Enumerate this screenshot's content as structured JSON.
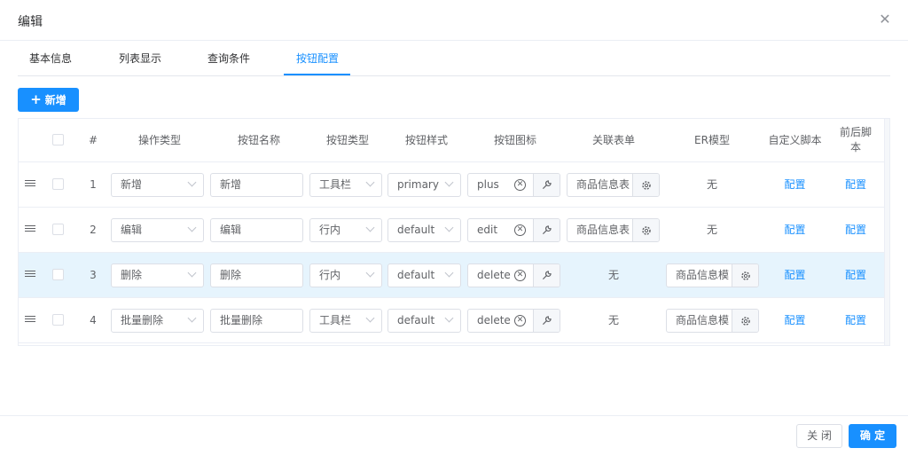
{
  "dialog": {
    "title": "编辑"
  },
  "tabs": [
    {
      "label": "基本信息"
    },
    {
      "label": "列表显示"
    },
    {
      "label": "查询条件"
    },
    {
      "label": "按钮配置",
      "active": true
    }
  ],
  "toolbar": {
    "add_label": "新增"
  },
  "table": {
    "headers": {
      "index": "#",
      "op_type": "操作类型",
      "btn_name": "按钮名称",
      "btn_type": "按钮类型",
      "btn_style": "按钮样式",
      "btn_icon": "按钮图标",
      "form": "关联表单",
      "er": "ER模型",
      "script": "自定义脚本",
      "prepost_line1": "前后脚",
      "prepost_line2": "本"
    },
    "rows": [
      {
        "index": "1",
        "op_type": "新增",
        "btn_name": "新增",
        "btn_type": "工具栏",
        "btn_style": "primary",
        "icon": "plus",
        "form": "商品信息表",
        "er": "无",
        "script": "配置",
        "prepost": "配置"
      },
      {
        "index": "2",
        "op_type": "编辑",
        "btn_name": "编辑",
        "btn_type": "行内",
        "btn_style": "default",
        "icon": "edit",
        "form": "商品信息表",
        "er": "无",
        "script": "配置",
        "prepost": "配置"
      },
      {
        "index": "3",
        "op_type": "删除",
        "btn_name": "删除",
        "btn_type": "行内",
        "btn_style": "default",
        "icon": "delete",
        "form": "无",
        "er": "商品信息模",
        "script": "配置",
        "prepost": "配置",
        "highlighted": true
      },
      {
        "index": "4",
        "op_type": "批量删除",
        "btn_name": "批量删除",
        "btn_type": "工具栏",
        "btn_style": "default",
        "icon": "delete",
        "form": "无",
        "er": "商品信息模",
        "script": "配置",
        "prepost": "配置"
      }
    ]
  },
  "footer": {
    "close_label": "关 闭",
    "ok_label": "确 定"
  },
  "colors": {
    "primary": "#1890ff",
    "border": "#dcdfe6",
    "highlight_row": "#e6f4fd",
    "text": "#606266"
  }
}
